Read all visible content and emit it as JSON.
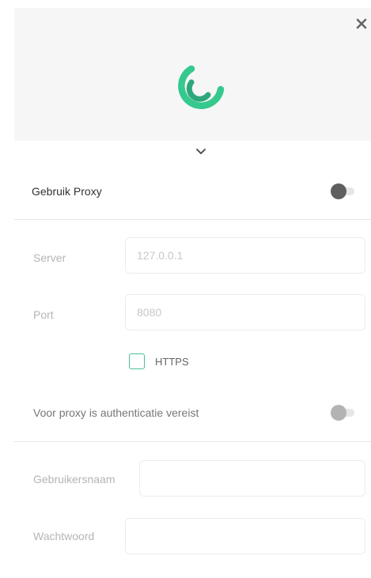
{
  "colors": {
    "accent": "#35c98e",
    "accent_dark": "#2ea77a",
    "toggle_off_dark": "#5f5f5f",
    "toggle_off_light": "#b3b3b3"
  },
  "icons": {
    "close": "close-icon",
    "logo": "app-logo",
    "expand": "chevron-down-icon"
  },
  "proxy": {
    "use_proxy_label": "Gebruik Proxy",
    "use_proxy_enabled": false,
    "server_label": "Server",
    "server_placeholder": "127.0.0.1",
    "server_value": "",
    "port_label": "Port",
    "port_placeholder": "8080",
    "port_value": "",
    "https_label": "HTTPS",
    "https_checked": false,
    "auth_label": "Voor proxy is authenticatie vereist",
    "auth_enabled": false,
    "username_label": "Gebruikersnaam",
    "username_value": "",
    "password_label": "Wachtwoord",
    "password_value": ""
  }
}
